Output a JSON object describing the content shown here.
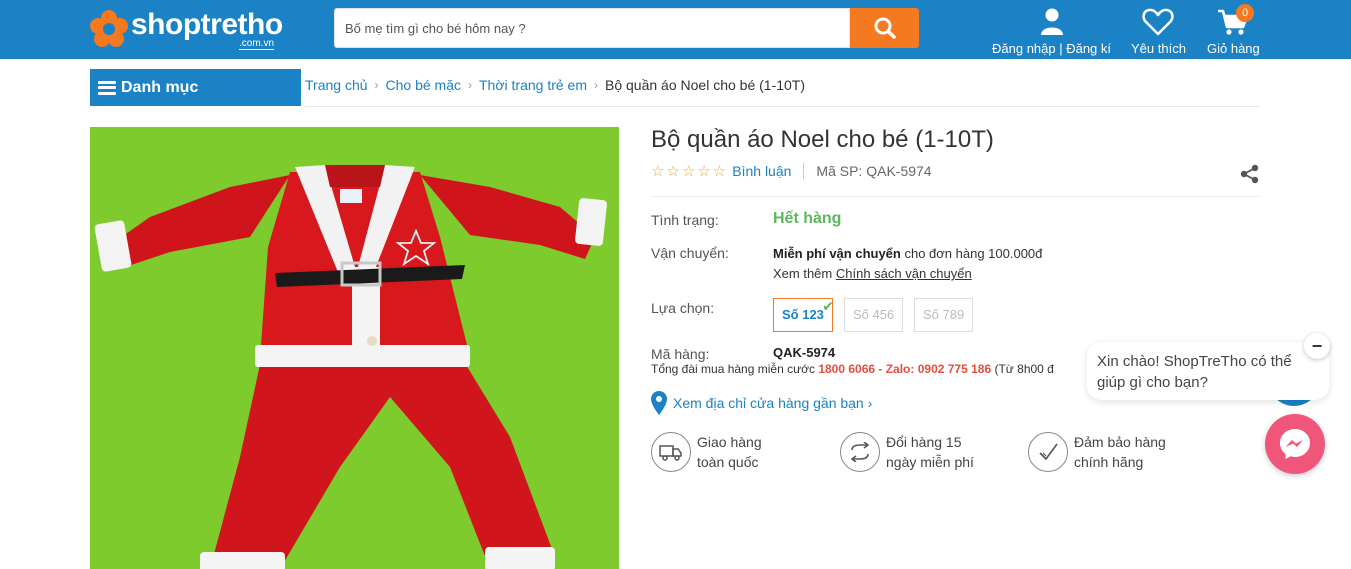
{
  "header": {
    "logo_text": "shoptretho",
    "logo_sub": ".com.vn",
    "search_placeholder": "Bố mẹ tìm gì cho bé hôm nay ?",
    "account_label": "Đăng nhập | Đăng kí",
    "wishlist_label": "Yêu thích",
    "cart_label": "Giỏ hàng",
    "cart_count": "0"
  },
  "nav": {
    "category_label": "Danh mục",
    "breadcrumb": [
      "Trang chủ",
      "Cho bé mặc",
      "Thời trang trẻ em"
    ],
    "breadcrumb_current": "Bộ quần áo Noel cho bé (1-10T)"
  },
  "product": {
    "title": "Bộ quần áo Noel cho bé (1-10T)",
    "stars": "☆☆☆☆☆",
    "review_label": "Bình luận",
    "sku_label": "Mã SP: QAK-5974",
    "status_label": "Tình trạng:",
    "status_value": "Hết hàng",
    "shipping_label": "Vận chuyển:",
    "shipping_bold": "Miễn phí vận chuyển",
    "shipping_rest": " cho đơn hàng 100.000đ",
    "shipping_more": "Xem thêm ",
    "shipping_policy": "Chính sách vận chuyển",
    "option_label": "Lựa chọn:",
    "options": [
      "Số 123",
      "Số 456",
      "Số 789"
    ],
    "code_label": "Mã hàng:",
    "code_value": "QAK-5974",
    "hotline_prefix": "Tổng đài mua hàng miễn cước ",
    "hotline_number": "1800 6066 - Zalo: 0902 775 186",
    "hotline_suffix": " (Từ 8h00 đ",
    "store_link": "Xem địa chỉ cửa hàng gần bạn ›",
    "features": [
      {
        "line1": "Giao hàng",
        "line2": "toàn quốc"
      },
      {
        "line1": "Đổi hàng 15",
        "line2": "ngày miễn phí"
      },
      {
        "line1": "Đảm bảo hàng",
        "line2": "chính hãng"
      }
    ]
  },
  "chat": {
    "greeting": "Xin chào! ShopTreTho có thể giúp gì cho bạn?",
    "close_symbol": "−"
  },
  "colors": {
    "brand_blue": "#1a82c5",
    "accent_orange": "#f47920",
    "status_green": "#5cb85c",
    "hotline_red": "#e74c3c",
    "messenger_pink": "#f0567a",
    "photo_background": "#7ecb2e"
  }
}
